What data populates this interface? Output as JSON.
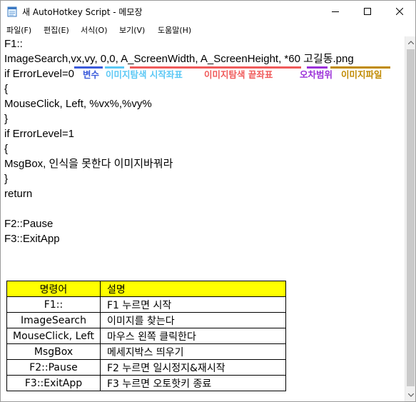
{
  "window": {
    "title": "새 AutoHotkey Script - 메모장",
    "icon": "notepad-icon",
    "buttons": [
      "minimize-icon",
      "maximize-icon",
      "close-icon"
    ]
  },
  "menu": [
    "파일(F)",
    "편집(E)",
    "서식(O)",
    "보기(V)",
    "도움말(H)"
  ],
  "code": {
    "l1": "F1::",
    "l2": "ImageSearch,vx,vy, 0,0, A_ScreenWidth, A_ScreenHeight, *60 고길동.png",
    "l3": "if ErrorLevel=0",
    "l4": "{",
    "l5": "MouseClick, Left, %vx%,%vy%",
    "l6": "}",
    "l7": "if ErrorLevel=1",
    "l8": "{",
    "l9": "MsgBox, 인식을 못한다 이미지바꿔라",
    "l10": "}",
    "l11": "return",
    "l12": "F2::Pause",
    "l13": "F3::ExitApp"
  },
  "annotations": {
    "a1": {
      "text": "변수",
      "color": "#3b5bdb"
    },
    "a2": {
      "text": "이미지탐색 시작좌표",
      "color": "#5bc8f5"
    },
    "a3": {
      "text": "이미지탐색 끝좌표",
      "color": "#f05a5a"
    },
    "a4": {
      "text": "오차범위",
      "color": "#9b30d9"
    },
    "a5": {
      "text": "이미지파일",
      "color": "#c08a00"
    }
  },
  "table": {
    "headers": [
      "명령어",
      "설명"
    ],
    "header_color": "#ffff00",
    "rows": [
      [
        "F1::",
        "F1 누르면 시작"
      ],
      [
        "ImageSearch",
        "이미지를 찾는다"
      ],
      [
        "MouseClick, Left",
        "마우스 왼쪽 클릭한다"
      ],
      [
        "MsgBox",
        "메세지박스 띄우기"
      ],
      [
        "F2::Pause",
        "F2 누르면 일시정지&재시작"
      ],
      [
        "F3::ExitApp",
        "F3 누르면 오토핫키 종료"
      ]
    ]
  }
}
